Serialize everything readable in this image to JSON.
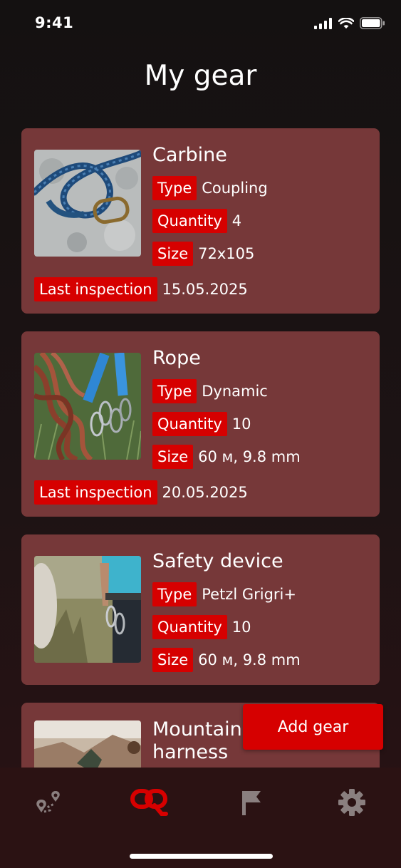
{
  "status_bar": {
    "time": "9:41"
  },
  "page": {
    "title": "My gear"
  },
  "gear": [
    {
      "name": "Carbine",
      "type_label": "Type",
      "type_value": "Coupling",
      "quantity_label": "Quantity",
      "quantity_value": "4",
      "size_label": "Size",
      "size_value": "72x105",
      "inspection_label": "Last inspection",
      "inspection_value": "15.05.2025"
    },
    {
      "name": "Rope",
      "type_label": "Type",
      "type_value": "Dynamic",
      "quantity_label": "Quantity",
      "quantity_value": "10",
      "size_label": "Size",
      "size_value": "60 м, 9.8 mm",
      "inspection_label": "Last inspection",
      "inspection_value": "20.05.2025"
    },
    {
      "name": "Safety device",
      "type_label": "Type",
      "type_value": "Petzl Grigri+",
      "quantity_label": "Quantity",
      "quantity_value": "10",
      "size_label": "Size",
      "size_value": "60 м, 9.8 mm"
    },
    {
      "name_line1": "Mountain",
      "name_line2": "harness"
    }
  ],
  "actions": {
    "add_gear": "Add gear"
  },
  "tab_bar": {
    "items": [
      {
        "icon": "map-pin-route-icon",
        "active": false
      },
      {
        "icon": "carabiner-gear-icon",
        "active": true
      },
      {
        "icon": "flag-icon",
        "active": false
      },
      {
        "icon": "gear-settings-icon",
        "active": false
      }
    ],
    "active_color": "#d60000",
    "inactive_color": "#8a7f7f"
  },
  "colors": {
    "card": "#763839",
    "accent": "#d60000",
    "background": "#161212"
  }
}
